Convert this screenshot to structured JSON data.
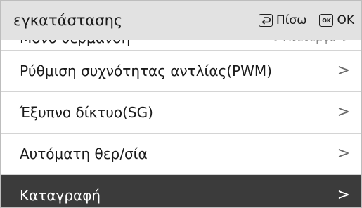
{
  "header": {
    "title": "εγκατάστασης",
    "back_label": "Πίσω",
    "ok_icon_text": "OK",
    "ok_label": "OK"
  },
  "menu": {
    "items": [
      {
        "label": "Μόνο θέρμανση",
        "value": "Ανενεργό",
        "chevron": ">"
      },
      {
        "label": "Ρύθμιση συχνότητας αντλίας(PWM)",
        "chevron": ">"
      },
      {
        "label": "Έξυπνο δίκτυο(SG)",
        "chevron": ">"
      },
      {
        "label": "Αυτόματη θερ/σία",
        "chevron": ">"
      },
      {
        "label": "Καταγραφή",
        "chevron": ">",
        "selected": true
      }
    ],
    "value_prev_chevron": "<"
  },
  "colors": {
    "header_bg": "#e2e2e2",
    "selected_bg": "#3b3b3b",
    "divider": "#d4d4d4"
  }
}
